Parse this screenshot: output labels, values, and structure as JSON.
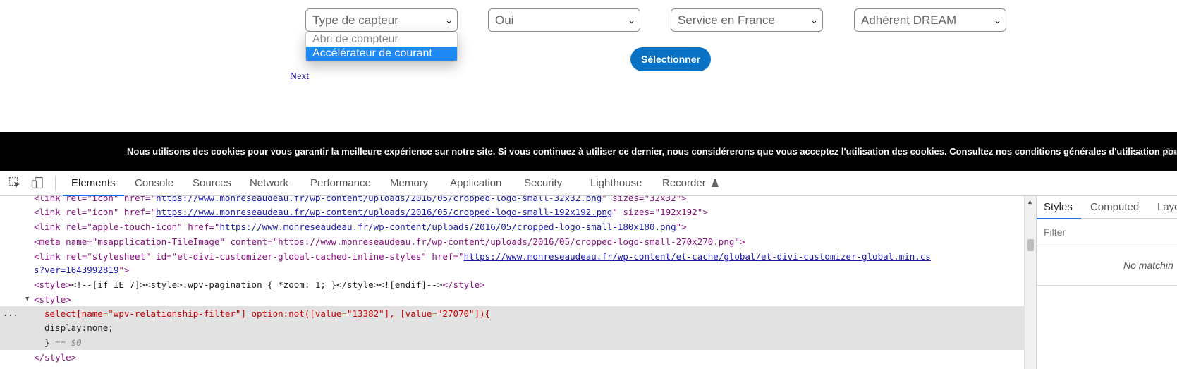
{
  "filters": {
    "capteur": {
      "value": "Type de capteur",
      "options": [
        "Abri de compteur",
        "Accélérateur de courant"
      ],
      "selected_option": "Accélérateur de courant"
    },
    "oui": {
      "value": "Oui"
    },
    "service": {
      "value": "Service en France"
    },
    "adherent": {
      "value": "Adhérent DREAM"
    }
  },
  "select_button": "Sélectionner",
  "next_link": "Next",
  "cookie_bar": {
    "text": "Nous utilisons des cookies pour vous garantir la meilleure expérience sur notre site. Si vous continuez à utiliser ce dernier, nous considérerons que vous acceptez l'utilisation des cookies. Consultez nos conditions générales d'utilisation pour en savoir plus.",
    "accept": "J'a"
  },
  "devtools": {
    "tabs": [
      "Elements",
      "Console",
      "Sources",
      "Network",
      "Performance",
      "Memory",
      "Application",
      "Security",
      "Lighthouse",
      "Recorder"
    ],
    "active_tab": "Elements",
    "styles_tabs": [
      "Styles",
      "Computed",
      "Layo"
    ],
    "filter_placeholder": "Filter",
    "no_matching": "No matchin",
    "code": {
      "l0": {
        "a": "<link rel=\"icon\" href=\"",
        "link": "https://www.monreseaudeau.fr/wp-content/uploads/2016/05/cropped-logo-small-32x32.png",
        "b": "\" sizes=\"32x32\">"
      },
      "l1": {
        "a": "<link rel=\"icon\" href=\"",
        "link": "https://www.monreseaudeau.fr/wp-content/uploads/2016/05/cropped-logo-small-192x192.png",
        "b": "\" sizes=\"192x192\">"
      },
      "l2": {
        "a": "<link rel=\"apple-touch-icon\" href=\"",
        "link": "https://www.monreseaudeau.fr/wp-content/uploads/2016/05/cropped-logo-small-180x180.png",
        "b": "\">"
      },
      "l3": {
        "a": "<meta name=\"msapplication-TileImage\" content=\"https://www.monreseaudeau.fr/wp-content/uploads/2016/05/cropped-logo-small-270x270.png\">"
      },
      "l4": {
        "a": "<link rel=\"stylesheet\" id=\"et-divi-customizer-global-cached-inline-styles\" href=\"",
        "link": "https://www.monreseaudeau.fr/wp-content/et-cache/global/et-divi-customizer-global.min.cs"
      },
      "l5": {
        "link": "s?ver=1643992819",
        "b": "\">"
      },
      "l6": {
        "a": "<style>",
        "b": "<!--[if IE 7]><style>.wpv-pagination { *zoom: 1; }</style><![endif]-->",
        "c": "</style>"
      },
      "l7": {
        "a": "<style>"
      },
      "l8": {
        "a": "select[name=\"wpv-relationship-filter\"] option:not([value=\"13382\"], [value=\"27070\"]){"
      },
      "l9": {
        "a": "display:none;"
      },
      "l10": {
        "a": "}",
        "b": " == $0"
      },
      "l11": {
        "a": "</style>"
      }
    },
    "dots": "..."
  }
}
